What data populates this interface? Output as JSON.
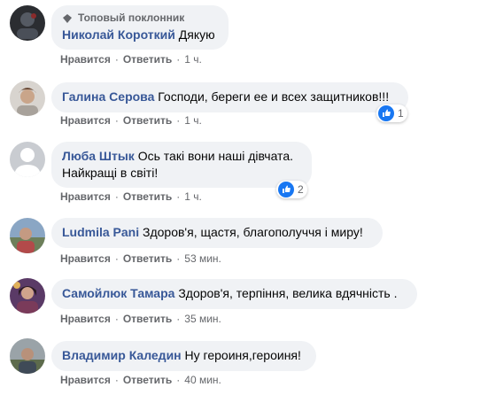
{
  "labels": {
    "like": "Нравится",
    "reply": "Ответить",
    "dot": "·",
    "top_fan": "Топовый поклонник"
  },
  "colors": {
    "bubble": "#f0f2f5",
    "author": "#385898",
    "meta": "#65676b",
    "like_blue": "#1877f2"
  },
  "comments": [
    {
      "author": "Николай Короткий",
      "text": "Дякую",
      "time": "1 ч.",
      "badge": "Топовый поклонник",
      "avatar": "dark-avatar"
    },
    {
      "author": "Галина Серова",
      "text": "Господи, береги ее и всех защитников!!!",
      "time": "1 ч.",
      "reactions": "1",
      "avatar": "photo-avatar"
    },
    {
      "author": "Люба Штык",
      "text": "Ось такі вони наші дівчата.",
      "text2": "Найкращі в світі!",
      "time": "1 ч.",
      "reactions": "2",
      "avatar": "default-avatar"
    },
    {
      "author": "Ludmila Pani",
      "text": "Здоров'я, щастя, благополуччя і миру!",
      "time": "53 мин.",
      "avatar": "photo-avatar"
    },
    {
      "author": "Самойлюк Тамара",
      "text": "Здоров'я, терпіння, велика вдячність .",
      "time": "35 мин.",
      "avatar": "photo-avatar"
    },
    {
      "author": "Владимир Каледин",
      "text": "Ну героиня,героиня!",
      "time": "40 мин.",
      "avatar": "photo-avatar"
    }
  ]
}
